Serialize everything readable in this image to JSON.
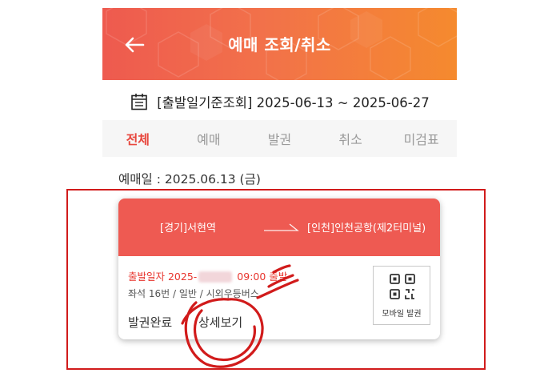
{
  "header": {
    "title": "예매 조회/취소",
    "back_icon": "back-arrow-icon"
  },
  "date_range": {
    "text": "[출발일기준조회] 2025-06-13 ~ 2025-06-27",
    "icon": "calendar-icon"
  },
  "tabs": [
    {
      "label": "전체",
      "active": true
    },
    {
      "label": "예매",
      "active": false
    },
    {
      "label": "발권",
      "active": false
    },
    {
      "label": "취소",
      "active": false
    },
    {
      "label": "미검표",
      "active": false
    }
  ],
  "reservation_date": "예매일 : 2025.06.13 (금)",
  "ticket": {
    "from": "[경기]서현역",
    "to": "[인천]인천공항(제2터미널)",
    "depart_prefix": "출발일자 2025-",
    "depart_suffix": "09:00 출발",
    "seat_info": "좌석 16번 / 일반 / 시외우등버스",
    "status": "발권완료",
    "detail_button": "상세보기",
    "mobile_ticket_label": "모바일 발권",
    "mobile_ticket_icon": "qr-code-icon"
  },
  "colors": {
    "accent": "#e8473e",
    "annotation": "#d11b1b",
    "header_start": "#ee5a4f",
    "header_end": "#f58a2e"
  }
}
